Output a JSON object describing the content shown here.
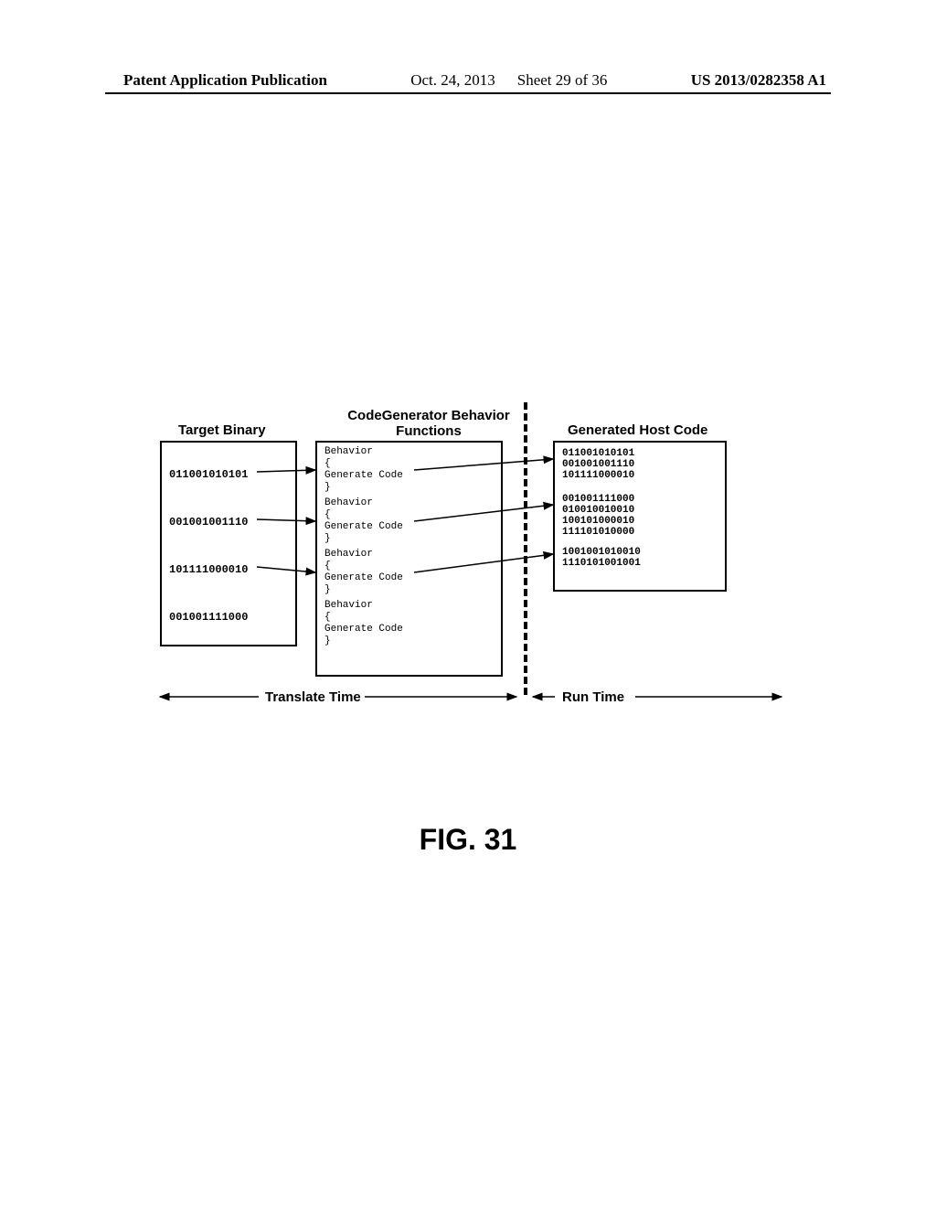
{
  "header": {
    "left": "Patent Application Publication",
    "date": "Oct. 24, 2013",
    "sheet": "Sheet 29 of 36",
    "pubno": "US 2013/0282358 A1"
  },
  "figure_label": "FIG. 31",
  "columns": {
    "target": "Target Binary",
    "generator": "CodeGenerator Behavior\nFunctions",
    "host": "Generated Host Code"
  },
  "target_binary": [
    "011001010101",
    "001001001110",
    "101111000010",
    "001001111000"
  ],
  "behavior_block": {
    "l1": "Behavior",
    "l2": "{",
    "l3": "Generate Code",
    "l4": "}"
  },
  "host_code": [
    [
      "011001010101",
      "001001001110",
      "101111000010"
    ],
    [
      "001001111000",
      "010010010010",
      "100101000010",
      "111101010000"
    ],
    [
      "1001001010010",
      "1110101001001"
    ]
  ],
  "timeline": {
    "translate": "Translate Time",
    "run": "Run Time"
  }
}
